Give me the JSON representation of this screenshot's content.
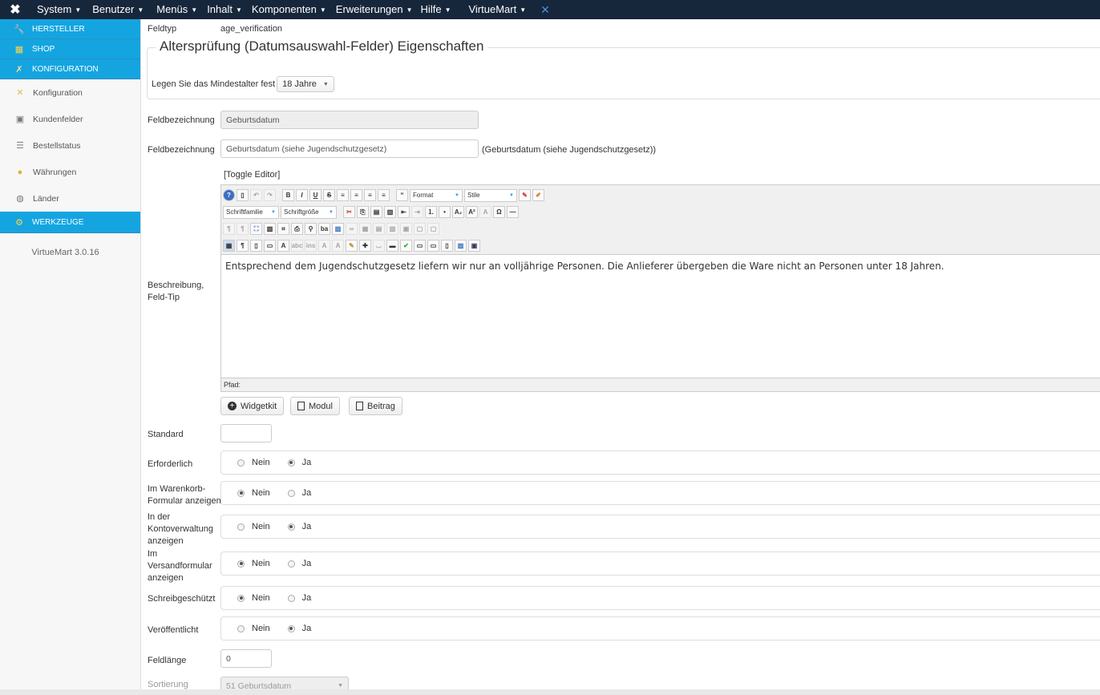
{
  "topbar": {
    "menus": [
      "System",
      "Benutzer",
      "Menüs",
      "Inhalt",
      "Komponenten",
      "Erweiterungen",
      "Hilfe",
      "VirtueMart"
    ]
  },
  "sidebar": {
    "sections": [
      {
        "label": "HERSTELLER",
        "icon": "wrench-icon"
      },
      {
        "label": "SHOP",
        "icon": "shop-icon"
      },
      {
        "label": "KONFIGURATION",
        "icon": "config-icon"
      }
    ],
    "items": [
      {
        "label": "Konfiguration",
        "icon": "tools-icon"
      },
      {
        "label": "Kundenfelder",
        "icon": "form-icon"
      },
      {
        "label": "Bestellstatus",
        "icon": "list-icon"
      },
      {
        "label": "Währungen",
        "icon": "coins-icon"
      },
      {
        "label": "Länder",
        "icon": "globe-icon"
      }
    ],
    "tools_section": {
      "label": "WERKZEUGE",
      "icon": "gear-icon"
    },
    "version": "VirtueMart 3.0.16"
  },
  "form": {
    "feldtyp_label": "Feldtyp",
    "feldtyp_value": "age_verification",
    "fieldset_legend": "Altersprüfung (Datumsauswahl-Felder) Eigenschaften",
    "min_age_label": "Legen Sie das Mindestalter fest",
    "min_age_value": "18 Jahre",
    "name_label": "Feldbezeichnung",
    "name_value": "Geburtsdatum",
    "title_label": "Feldbezeichnung",
    "title_value": "Geburtsdatum (siehe Jugendschutzgesetz)",
    "title_preview": "(Geburtsdatum (siehe Jugendschutzgesetz))",
    "toggle_editor": "[Toggle Editor]",
    "desc_label_1": "Beschreibung,",
    "desc_label_2": "Feld-Tip",
    "editor_format": "Format",
    "editor_style": "Stile",
    "editor_font_family": "Schriftfamilie",
    "editor_font_size": "Schriftgröße",
    "editor_content": "Entsprechend dem Jugendschutzgesetz liefern wir nur an volljährige Personen. Die Anlieferer übergeben die Ware nicht an Personen unter 18 Jahren.",
    "editor_path": "Pfad:",
    "btn_widgetkit": "Widgetkit",
    "btn_modul": "Modul",
    "btn_beitrag": "Beitrag",
    "standard_label": "Standard",
    "standard_value": "",
    "radio_no": "Nein",
    "radio_yes": "Ja",
    "radios": [
      {
        "label_lines": [
          "Erforderlich"
        ],
        "selected": "Ja"
      },
      {
        "label_lines": [
          "Im Warenkorb-",
          "Formular anzeigen"
        ],
        "selected": "Nein"
      },
      {
        "label_lines": [
          "In der",
          "Kontoverwaltung",
          "anzeigen"
        ],
        "selected": "Ja"
      },
      {
        "label_lines": [
          "Im",
          "Versandformular",
          "anzeigen"
        ],
        "selected": "Nein"
      },
      {
        "label_lines": [
          "Schreibgeschützt"
        ],
        "selected": "Nein"
      },
      {
        "label_lines": [
          "Veröffentlicht"
        ],
        "selected": "Ja"
      }
    ],
    "length_label": "Feldlänge",
    "length_value": "0",
    "sort_label": "Sortierung",
    "sort_value": "51 Geburtsdatum"
  }
}
